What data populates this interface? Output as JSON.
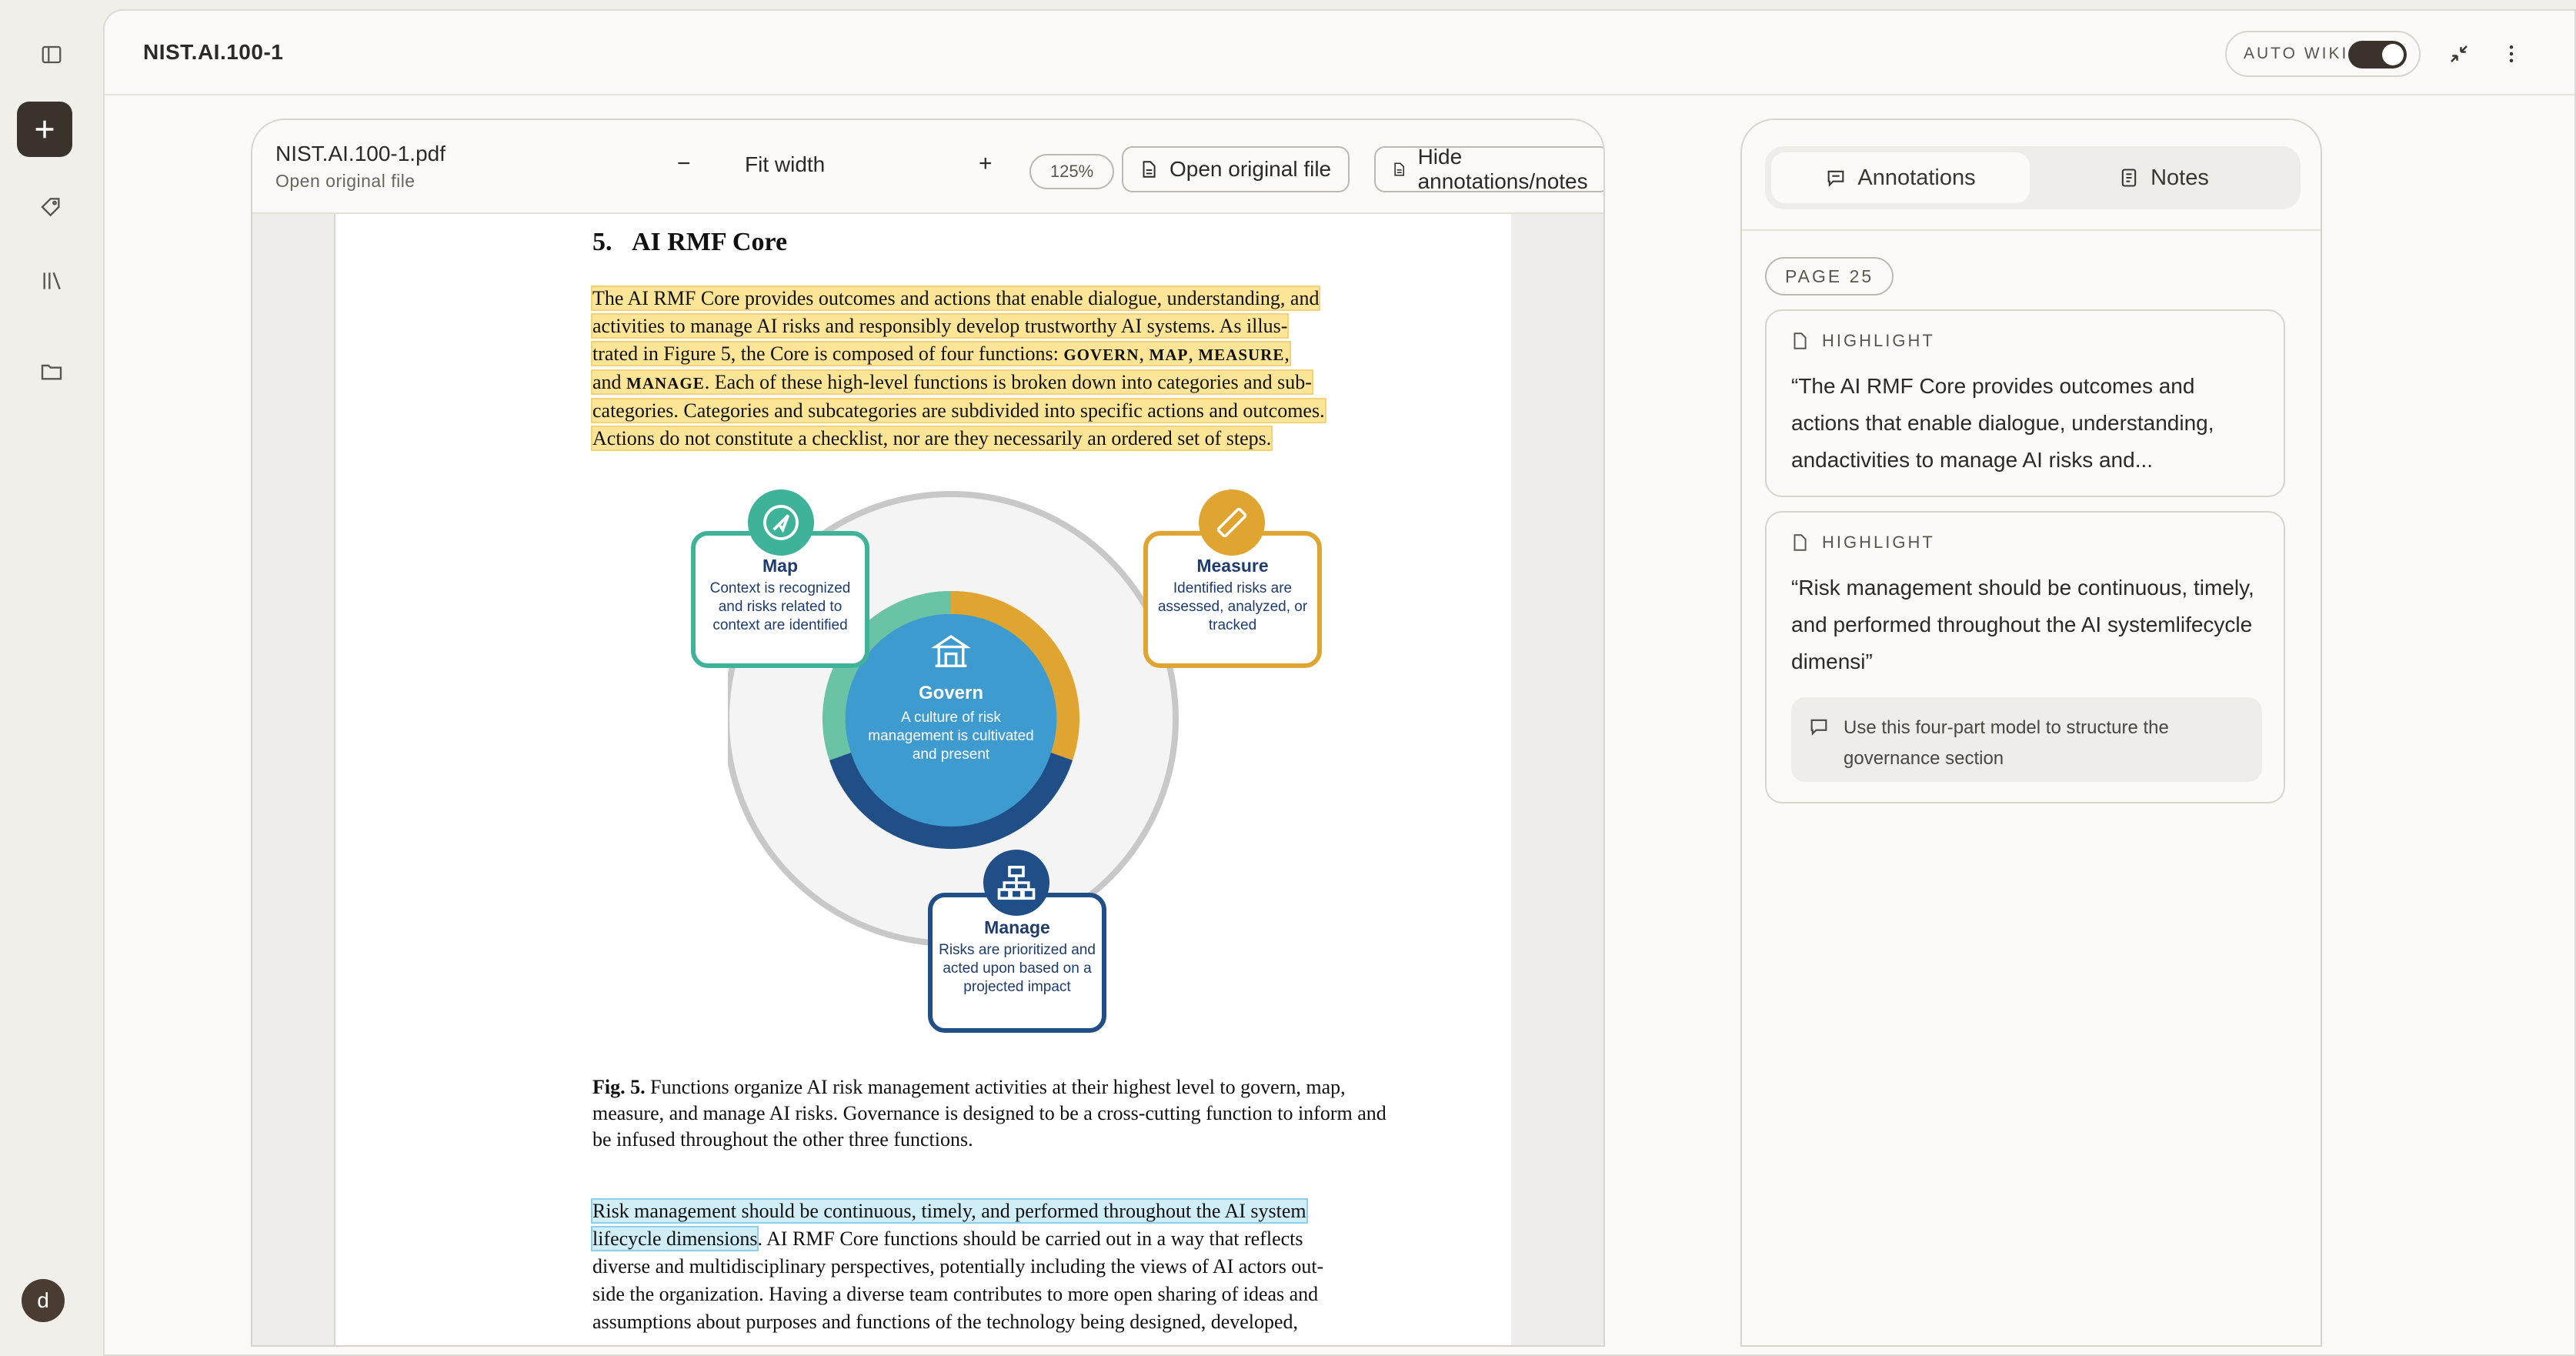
{
  "app": {
    "doc_title": "NIST.AI.100-1",
    "user_initial": "d"
  },
  "rail": {
    "icons": [
      "sidebar-toggle-icon",
      "plus-icon",
      "tags-icon",
      "library-icon",
      "folder-icon"
    ]
  },
  "topbar": {
    "auto_wiki_label": "AUTO WIKI",
    "auto_wiki_on": true
  },
  "pdf": {
    "file_name": "NIST.AI.100-1.pdf",
    "subtitle": "Open original file",
    "zoom_out": "−",
    "fit_label": "Fit width",
    "zoom_in": "+",
    "zoom_level": "125%",
    "open_original_label": "Open original file",
    "hide_annotations_label": "Hide annotations/notes"
  },
  "page": {
    "section_number": "5.",
    "section_title": "AI RMF Core",
    "p1": {
      "l1": "The AI RMF Core provides outcomes and actions that enable dialogue, understanding, and",
      "l2": "activities to manage AI risks and responsibly develop trustworthy AI systems.  As illus-",
      "l3a": "trated in Figure 5, the Core is composed of four functions: ",
      "l3_govern": "GOVERN",
      "l3_sep1": ", ",
      "l3_map": "MAP",
      "l3_sep2": ", ",
      "l3_measure": "MEASURE",
      "l3_end": ",",
      "l4a": "and ",
      "l4_manage": "MANAGE",
      "l4b": ".  Each of these high-level functions is broken down into categories and sub-",
      "l5": "categories. Categories and subcategories are subdivided into specific actions and outcomes.",
      "l6": "Actions do not constitute a checklist, nor are they necessarily an ordered set of steps."
    },
    "figure": {
      "map_title": "Map",
      "map_text": "Context is recognized and risks related to context are identified",
      "measure_title": "Measure",
      "measure_text": "Identified risks are assessed, analyzed, or tracked",
      "govern_title": "Govern",
      "govern_text": "A culture of risk management is cultivated and present",
      "manage_title": "Manage",
      "manage_text": "Risks are prioritized and acted upon based on a projected impact",
      "colors": {
        "map": "#3fb39a",
        "measure": "#e0a530",
        "govern": "#3e9bd0",
        "manage": "#1f4f86"
      }
    },
    "caption_label": "Fig. 5.",
    "caption_text": "Functions organize AI risk management activities at their highest level to govern, map, measure, and manage AI risks. Governance is designed to be a cross-cutting function to inform and be infused throughout the other three functions.",
    "p2": {
      "l1": "Risk management should be continuous, timely, and performed throughout the AI system",
      "l2a": "lifecycle dimensions",
      "l2b": ".  AI RMF Core functions should be carried out in a way that reflects",
      "l3": "diverse and multidisciplinary perspectives, potentially including the views of AI actors out-",
      "l4": "side the organization. Having a diverse team contributes to more open sharing of ideas and",
      "l5": "assumptions about purposes and functions of the technology being designed, developed,"
    }
  },
  "annotations": {
    "tab_annotations": "Annotations",
    "tab_notes": "Notes",
    "page_label": "PAGE 25",
    "items": [
      {
        "type": "HIGHLIGHT",
        "quote": "“The AI RMF Core provides outcomes and actions that enable dialogue, understanding, andactivities to manage AI risks and...",
        "highlight_color": "#facf40"
      },
      {
        "type": "HIGHLIGHT",
        "quote": "“Risk management should be continuous, timely, and performed throughout the AI systemlifecycle dimensi”",
        "note": "Use this four-part model to structure the governance section",
        "highlight_color": "#78cdeb"
      }
    ]
  }
}
